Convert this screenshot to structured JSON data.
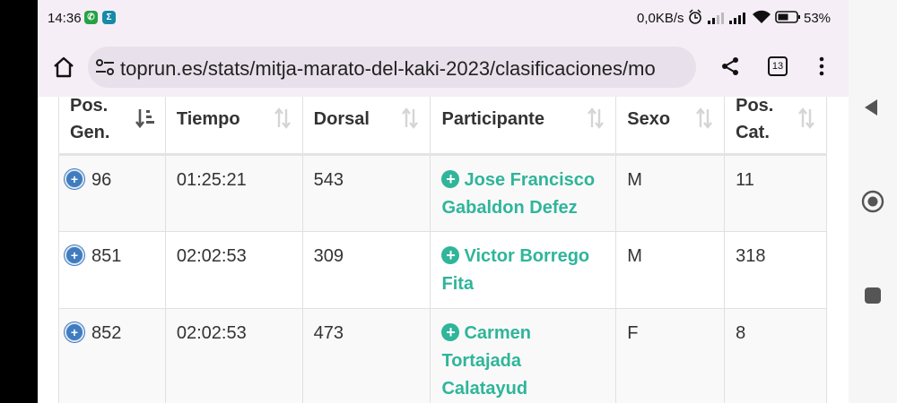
{
  "status_bar": {
    "time": "14:36",
    "app_badge_1": "whatsapp-icon",
    "app_badge_2": "sigma-icon",
    "network_speed": "0,0KB/s",
    "battery": "53%"
  },
  "browser": {
    "url": "toprun.es/stats/mitja-marato-del-kaki-2023/clasificaciones/mo",
    "tab_count": "13"
  },
  "table": {
    "headers": {
      "pos_gen_1": "Pos.",
      "pos_gen_2": "Gen.",
      "tiempo": "Tiempo",
      "dorsal": "Dorsal",
      "participante": "Participante",
      "sexo": "Sexo",
      "pos_cat_1": "Pos.",
      "pos_cat_2": "Cat."
    },
    "rows": [
      {
        "pos_gen": "96",
        "tiempo": "01:25:21",
        "dorsal": "543",
        "participante": "Jose Francisco Gabaldon Defez",
        "sexo": "M",
        "pos_cat": "11"
      },
      {
        "pos_gen": "851",
        "tiempo": "02:02:53",
        "dorsal": "309",
        "participante": "Victor Borrego Fita",
        "sexo": "M",
        "pos_cat": "318"
      },
      {
        "pos_gen": "852",
        "tiempo": "02:02:53",
        "dorsal": "473",
        "participante": "Carmen Tortajada Calatayud",
        "sexo": "F",
        "pos_cat": "8"
      }
    ]
  },
  "colors": {
    "link_green": "#2fb59a",
    "expand_blue": "#3f7cc0",
    "browser_bg": "#f5eef6"
  }
}
